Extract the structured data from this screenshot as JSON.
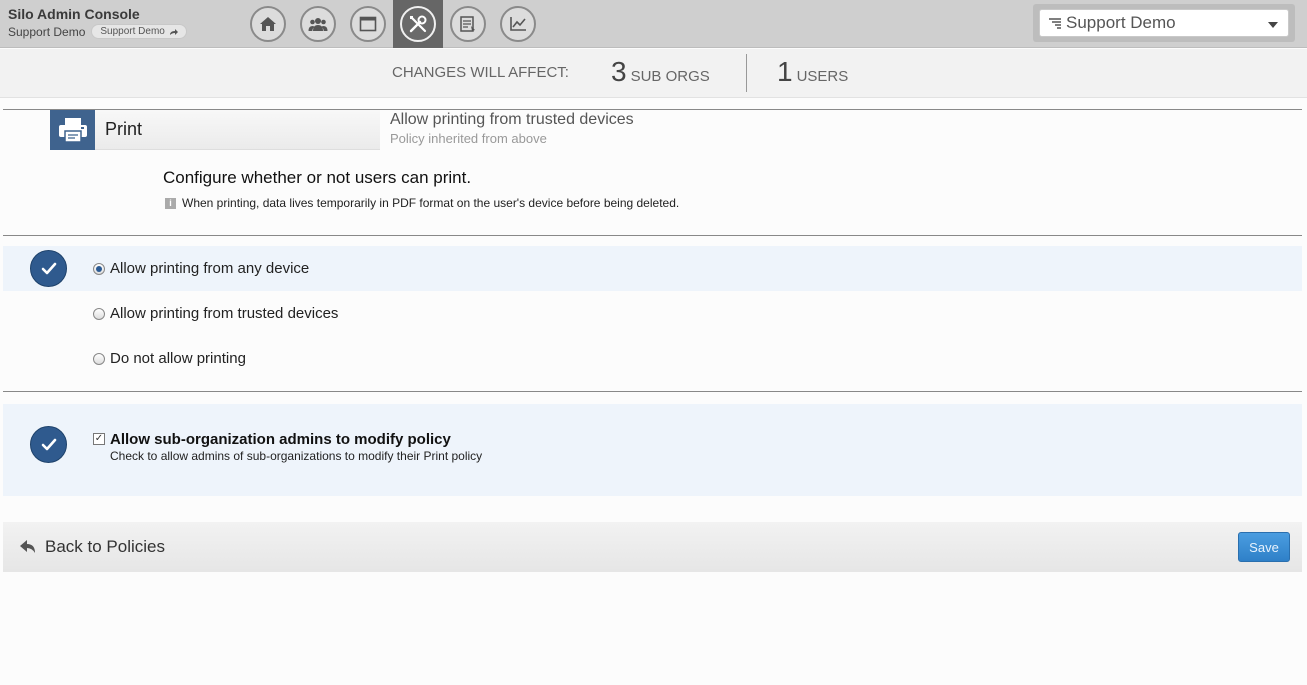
{
  "header": {
    "app_title": "Silo Admin Console",
    "org_name": "Support Demo",
    "org_chip": "Support Demo",
    "nav_items": [
      "home-icon",
      "users-icon",
      "window-icon",
      "tools-icon",
      "reports-icon",
      "analytics-icon"
    ],
    "active_nav": "tools-icon",
    "org_selector": {
      "value": "Support Demo"
    }
  },
  "affect_bar": {
    "label": "CHANGES WILL AFFECT:",
    "sub_orgs_count": "3",
    "sub_orgs_label": "SUB ORGS",
    "users_count": "1",
    "users_label": "USERS"
  },
  "policy": {
    "tab_label": "Print",
    "current_setting": "Allow printing from trusted devices",
    "inherited_note": "Policy inherited from above",
    "description": "Configure whether or not users can print.",
    "info": "When printing, data lives temporarily in PDF format on the user's device before being deleted.",
    "options": [
      {
        "label": "Allow printing from any device",
        "selected": true
      },
      {
        "label": "Allow printing from trusted devices",
        "selected": false
      },
      {
        "label": "Do not allow printing",
        "selected": false
      }
    ],
    "suborg_toggle": {
      "label": "Allow sub-organization admins to modify policy",
      "help": "Check to allow admins of sub-organizations to modify their Print policy",
      "checked": true
    }
  },
  "footer": {
    "back_label": "Back to Policies",
    "save_label": "Save"
  },
  "colors": {
    "accent": "#2f5a8e",
    "save_button": "#3a8fd6",
    "topbar": "#cfcfcf"
  }
}
